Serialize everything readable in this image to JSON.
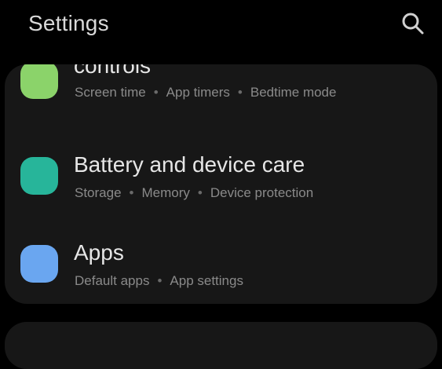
{
  "header": {
    "title": "Settings",
    "search_icon": "search-icon"
  },
  "rows": [
    {
      "title": "controls",
      "icon_color": "#8bd36a",
      "subtitles": [
        "Screen time",
        "App timers",
        "Bedtime mode"
      ]
    },
    {
      "title": "Battery and device care",
      "icon_color": "#27b59a",
      "subtitles": [
        "Storage",
        "Memory",
        "Device protection"
      ]
    },
    {
      "title": "Apps",
      "icon_color": "#6aa6f0",
      "subtitles": [
        "Default apps",
        "App settings"
      ]
    }
  ],
  "separator": "•"
}
